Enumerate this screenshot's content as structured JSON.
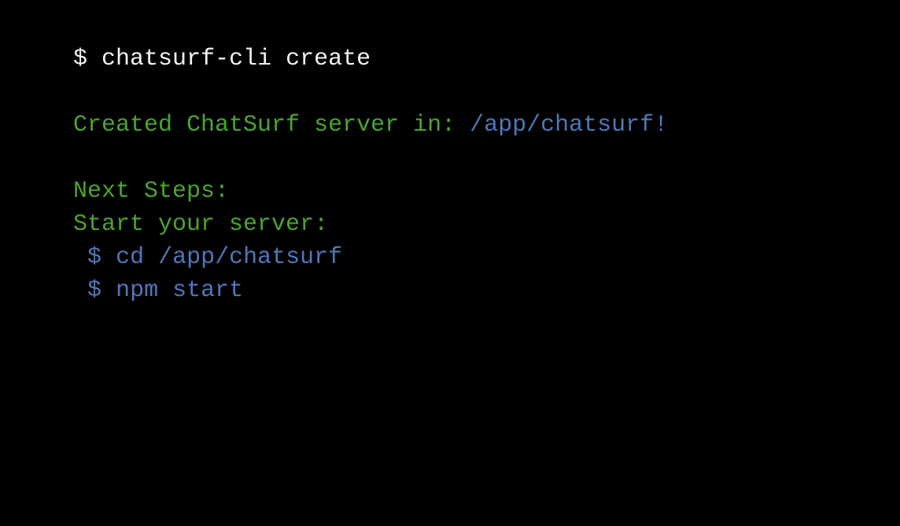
{
  "terminal": {
    "background": "#000000",
    "colors": {
      "prompt_text": "#f2f2f2",
      "success_text": "#4aa52e",
      "path_text": "#4e77b8"
    },
    "command_line": {
      "prompt": "$",
      "command": "chatsurf-cli create"
    },
    "created_message": {
      "text": "Created ChatSurf server in:",
      "path": "/app/chatsurf!"
    },
    "next_steps_heading": "Next Steps:",
    "start_server_label": "Start your server:",
    "steps": [
      {
        "prompt": "$",
        "command": "cd /app/chatsurf"
      },
      {
        "prompt": "$",
        "command": "npm start"
      }
    ]
  }
}
